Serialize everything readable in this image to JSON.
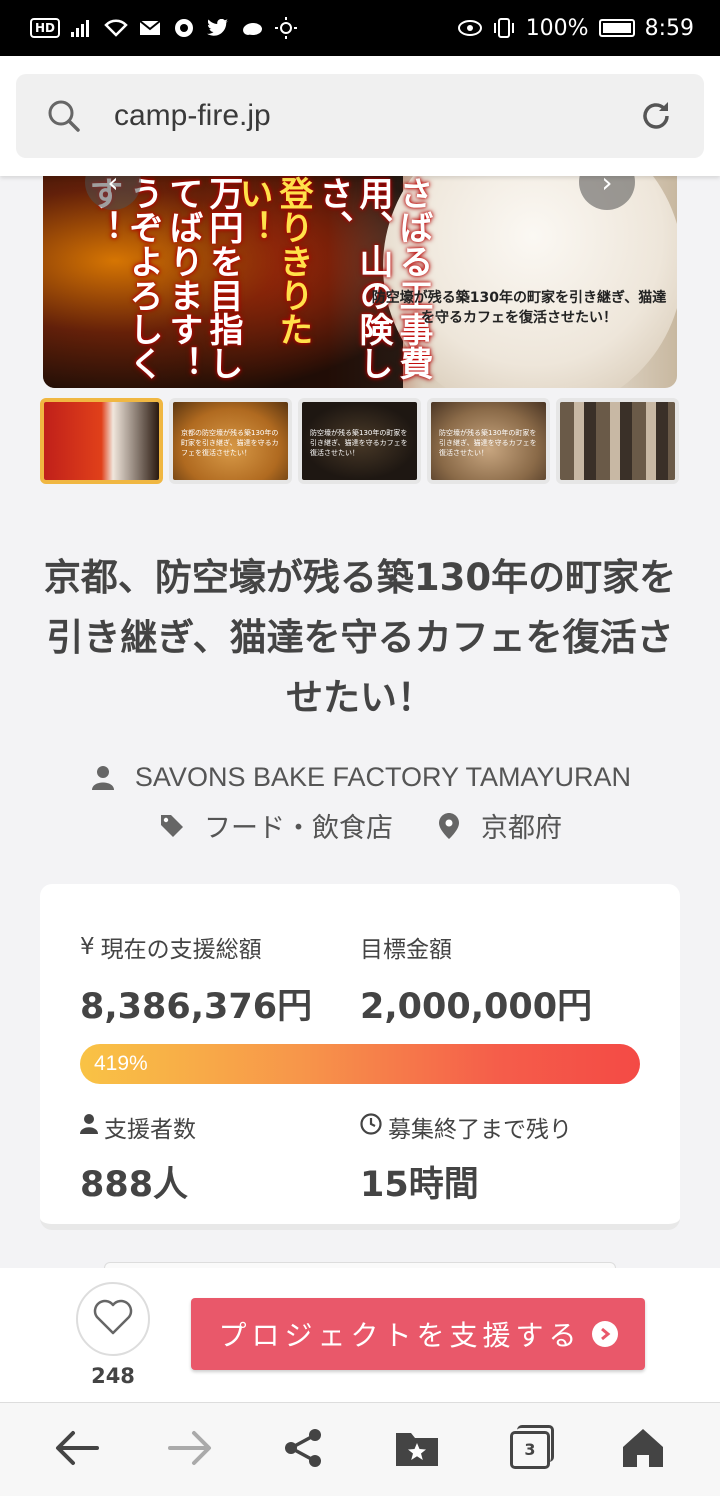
{
  "status_bar": {
    "battery": "100%",
    "time": "8:59",
    "hd_label": "HD"
  },
  "url_bar": {
    "url": "camp-fire.jp",
    "search_icon": "search-icon",
    "reload_icon": "reload-icon"
  },
  "hero": {
    "vertical_texts": [
      "うぞよろしくす！",
      "万円を目指してばります！",
      "登りきりたい！",
      "さばる工事費用、山の険しさ、"
    ],
    "caption": "防空壕が残る築130年の町家を引き継ぎ、猫達を守るカフェを復活させたい！"
  },
  "thumbnails": [
    {
      "active": true,
      "text": ""
    },
    {
      "active": false,
      "text": "京都の防空壕が残る築130年の町家を引き継ぎ、猫達を守るカフェを復活させたい！"
    },
    {
      "active": false,
      "text": "防空壕が残る築130年の町家を引き継ぎ、猫達を守るカフェを復活させたい！"
    },
    {
      "active": false,
      "text": "防空壕が残る築130年の町家を引き継ぎ、猫達を守るカフェを復活させたい！"
    },
    {
      "active": false,
      "text": ""
    }
  ],
  "project": {
    "title": "京都、防空壕が残る築130年の町家を引き継ぎ、猫達を守るカフェを復活させたい！",
    "owner": "SAVONS BAKE FACTORY TAMAYURAN",
    "category": "フード・飲食店",
    "location": "京都府"
  },
  "stats": {
    "raised_label": "現在の支援総額",
    "raised_prefix": "¥",
    "raised_value": "8,386,376円",
    "goal_label": "目標金額",
    "goal_value": "2,000,000円",
    "progress_text": "419%",
    "progress_percent": 419,
    "backers_label": "支援者数",
    "backers_value": "888人",
    "remaining_label": "募集終了まで残り",
    "remaining_value": "15時間"
  },
  "actions": {
    "like_count": "248",
    "support_label": "プロジェクトを支援する"
  },
  "nav": {
    "tab_count": "3"
  },
  "colors": {
    "support_button": "#e9586a",
    "progress_start": "#f9c345",
    "progress_end": "#f44a45",
    "active_thumb_border": "#f0b742"
  }
}
